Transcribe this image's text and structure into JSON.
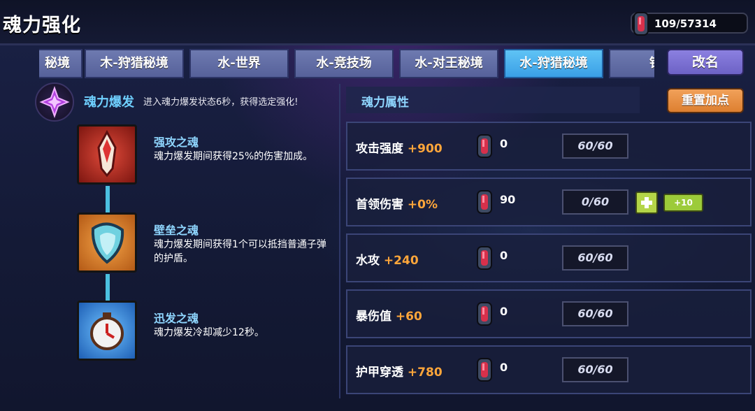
{
  "header": {
    "title": "魂力强化",
    "currency": "109/57314",
    "currency_icon": "soul-gem-icon"
  },
  "tabs": [
    {
      "label": "秘境",
      "active": false
    },
    {
      "label": "木-狩猎秘境",
      "active": false
    },
    {
      "label": "水-世界",
      "active": false
    },
    {
      "label": "水-竞技场",
      "active": false
    },
    {
      "label": "水-对王秘境",
      "active": false
    },
    {
      "label": "水-狩猎秘境",
      "active": true
    },
    {
      "label": "铁",
      "active": false
    }
  ],
  "buttons": {
    "rename": "改名",
    "reset": "重置加点"
  },
  "burst": {
    "title": "魂力爆发",
    "description": "进入魂力爆发状态6秒，获得选定强化!"
  },
  "skills": [
    {
      "name": "强攻之魂",
      "description": "魂力爆发期间获得25%的伤害加成。",
      "icon": "attack-soul-icon",
      "color": "#b3281f"
    },
    {
      "name": "壁垒之魂",
      "description": "魂力爆发期间获得1个可以抵挡普通子弹的护盾。",
      "icon": "shield-soul-icon",
      "color": "#d9782a"
    },
    {
      "name": "迅发之魂",
      "description": "魂力爆发冷却减少12秒。",
      "icon": "clock-soul-icon",
      "color": "#3a93e0"
    }
  ],
  "attributes": {
    "title": "魂力属性",
    "rows": [
      {
        "label": "攻击强度",
        "bonus": "+900",
        "cost": "0",
        "progress": "60/60"
      },
      {
        "label": "首领伤害",
        "bonus": "+0%",
        "cost": "90",
        "progress": "0/60",
        "plus_ten": "+10"
      },
      {
        "label": "水攻",
        "bonus": "+240",
        "cost": "0",
        "progress": "60/60"
      },
      {
        "label": "暴伤值",
        "bonus": "+60",
        "cost": "0",
        "progress": "60/60"
      },
      {
        "label": "护甲穿透",
        "bonus": "+780",
        "cost": "0",
        "progress": "60/60"
      }
    ]
  },
  "colors": {
    "accent_blue": "#3a9fe6",
    "bonus_orange": "#ffa63a",
    "reset_orange": "#dd7f30",
    "rename_purple": "#6d62c5",
    "plus_green": "#b4d548"
  }
}
